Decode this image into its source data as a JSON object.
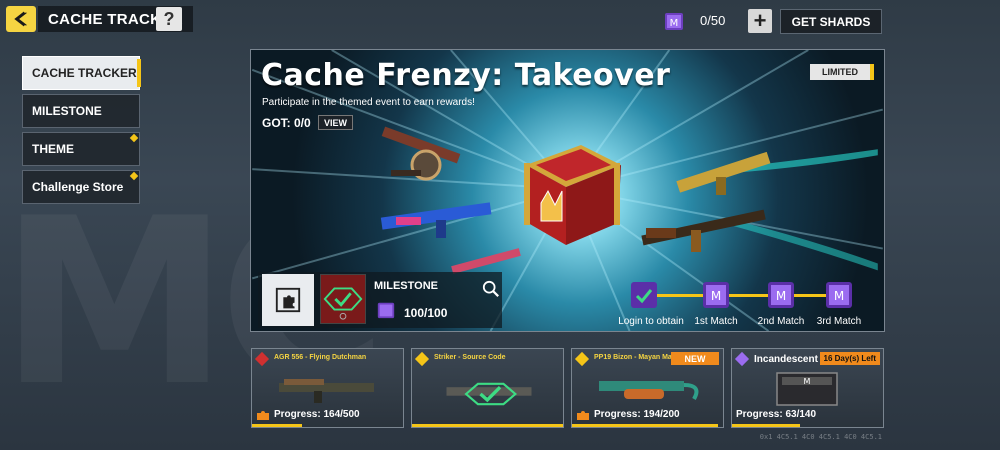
{
  "header": {
    "title": "CACHE TRACKER",
    "help_label": "?",
    "shards": "0/50",
    "plus_label": "+",
    "get_shards_label": "GET SHARDS"
  },
  "sidebar": {
    "items": [
      {
        "label": "CACHE TRACKER",
        "active": true
      },
      {
        "label": "MILESTONE"
      },
      {
        "label": "THEME",
        "dot": true
      },
      {
        "label": "Challenge Store",
        "dot": true
      }
    ]
  },
  "banner": {
    "title": "Cache Frenzy: Takeover",
    "subtitle": "Participate in the themed event to earn rewards!",
    "got": "GOT: 0/0",
    "view_label": "VIEW",
    "limited_label": "LIMITED",
    "milestone_label": "MILESTONE",
    "milestone_progress": "100/100",
    "track": [
      "Login to obtain",
      "1st Match",
      "2nd Match",
      "3rd Match"
    ]
  },
  "cards": [
    {
      "title": "AGR 556 - Flying Dutchman",
      "progress": "Progress: 164/500",
      "fraction": 0.328
    },
    {
      "title": "Striker - Source Code",
      "progress": "",
      "fraction": 1.0,
      "completed": true
    },
    {
      "title": "PP19 Bizon - Mayan Malediction",
      "progress": "Progress: 194/200",
      "fraction": 0.97,
      "badge": "NEW"
    },
    {
      "title": "Incandescent",
      "progress": "Progress: 63/140",
      "fraction": 0.45,
      "badge": "16 Day(s) Left"
    }
  ],
  "footer_code": "0x1 4C5.1 4C0 4C5.1 4C0 4C5.1",
  "colors": {
    "accent": "#f5c518",
    "badge_orange": "#f08a1c",
    "purple_shard": "#8b5cf6"
  }
}
